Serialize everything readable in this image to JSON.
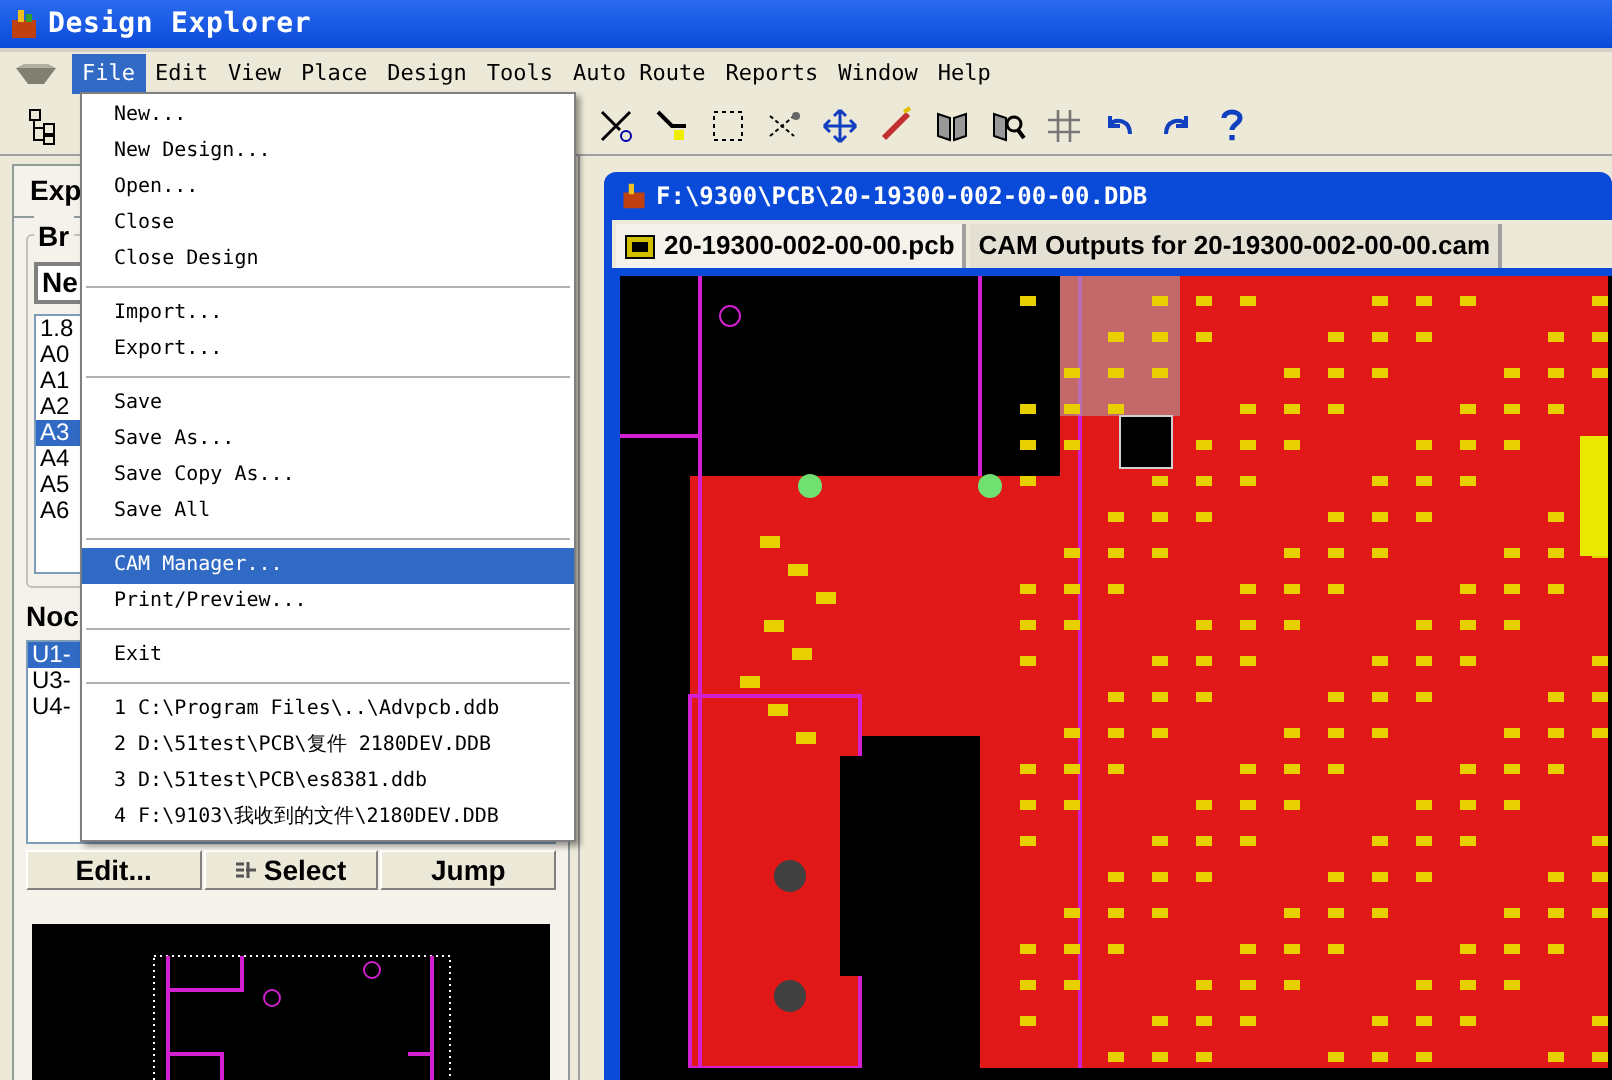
{
  "window": {
    "title": "Design Explorer"
  },
  "menu_bar": [
    {
      "label": "File",
      "selected": true
    },
    {
      "label": "Edit",
      "selected": false
    },
    {
      "label": "View",
      "selected": false
    },
    {
      "label": "Place",
      "selected": false
    },
    {
      "label": "Design",
      "selected": false
    },
    {
      "label": "Tools",
      "selected": false
    },
    {
      "label": "Auto Route",
      "selected": false
    },
    {
      "label": "Reports",
      "selected": false
    },
    {
      "label": "Window",
      "selected": false
    },
    {
      "label": "Help",
      "selected": false
    }
  ],
  "file_menu": [
    {
      "kind": "item",
      "label": "New...",
      "selected": false
    },
    {
      "kind": "item",
      "label": "New Design...",
      "selected": false
    },
    {
      "kind": "item",
      "label": "Open...",
      "selected": false
    },
    {
      "kind": "item",
      "label": "Close",
      "selected": false
    },
    {
      "kind": "item",
      "label": "Close Design",
      "selected": false
    },
    {
      "kind": "separator"
    },
    {
      "kind": "item",
      "label": "Import...",
      "selected": false
    },
    {
      "kind": "item",
      "label": "Export...",
      "selected": false
    },
    {
      "kind": "separator"
    },
    {
      "kind": "item",
      "label": "Save",
      "selected": false
    },
    {
      "kind": "item",
      "label": "Save As...",
      "selected": false
    },
    {
      "kind": "item",
      "label": "Save Copy As...",
      "selected": false
    },
    {
      "kind": "item",
      "label": "Save All",
      "selected": false
    },
    {
      "kind": "separator"
    },
    {
      "kind": "item",
      "label": "CAM Manager...",
      "selected": true
    },
    {
      "kind": "item",
      "label": "Print/Preview...",
      "selected": false
    },
    {
      "kind": "separator"
    },
    {
      "kind": "item",
      "label": "Exit",
      "selected": false
    },
    {
      "kind": "separator"
    },
    {
      "kind": "item",
      "label": "1 C:\\Program Files\\..\\Advpcb.ddb",
      "selected": false
    },
    {
      "kind": "item",
      "label": "2 D:\\51test\\PCB\\复件 2180DEV.DDB",
      "selected": false
    },
    {
      "kind": "item",
      "label": "3 D:\\51test\\PCB\\es8381.ddb",
      "selected": false
    },
    {
      "kind": "item",
      "label": "4 F:\\9103\\我收到的文件\\2180DEV.DDB",
      "selected": false
    }
  ],
  "left_panel": {
    "tab": "Exp",
    "group": "Br",
    "combo": "Ne",
    "components": [
      {
        "label": "1.8",
        "selected": false
      },
      {
        "label": "A0",
        "selected": false
      },
      {
        "label": "A1",
        "selected": false
      },
      {
        "label": "A2",
        "selected": false
      },
      {
        "label": "A3",
        "selected": true
      },
      {
        "label": "A4",
        "selected": false
      },
      {
        "label": "A5",
        "selected": false
      },
      {
        "label": "A6",
        "selected": false
      }
    ],
    "nodes_label": "Noc",
    "nodes": [
      {
        "label": "U1-",
        "selected": true
      },
      {
        "label": "U3-",
        "selected": false
      },
      {
        "label": "U4-",
        "selected": false
      }
    ],
    "buttons": [
      "Edit...",
      "Select",
      "Jump"
    ]
  },
  "document": {
    "title": "F:\\9300\\PCB\\20-19300-002-00-00.DDB",
    "tabs": [
      {
        "label": "20-19300-002-00-00.pcb",
        "selected": true
      },
      {
        "label": "CAM Outputs for 20-19300-002-00-00.cam",
        "selected": false
      }
    ]
  }
}
